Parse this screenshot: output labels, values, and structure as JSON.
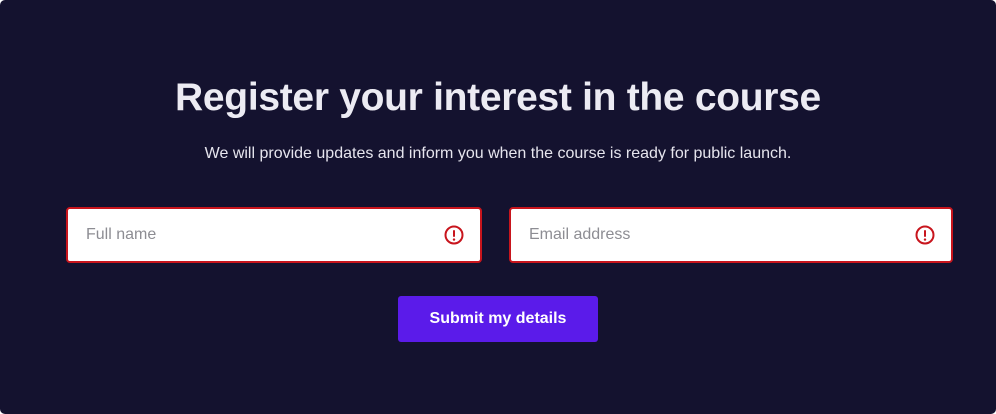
{
  "form": {
    "title": "Register your interest in the course",
    "subtitle": "We will provide updates and inform you when the course is ready for public launch.",
    "full_name": {
      "placeholder": "Full name",
      "value": "",
      "state": "error",
      "icon": "error-icon"
    },
    "email": {
      "placeholder": "Email address",
      "value": "",
      "state": "error",
      "icon": "error-icon"
    },
    "submit_label": "Submit my details"
  },
  "colors": {
    "background": "#14122f",
    "error": "#c8151d",
    "accent": "#5b1bea",
    "text": "#ecebf3"
  }
}
